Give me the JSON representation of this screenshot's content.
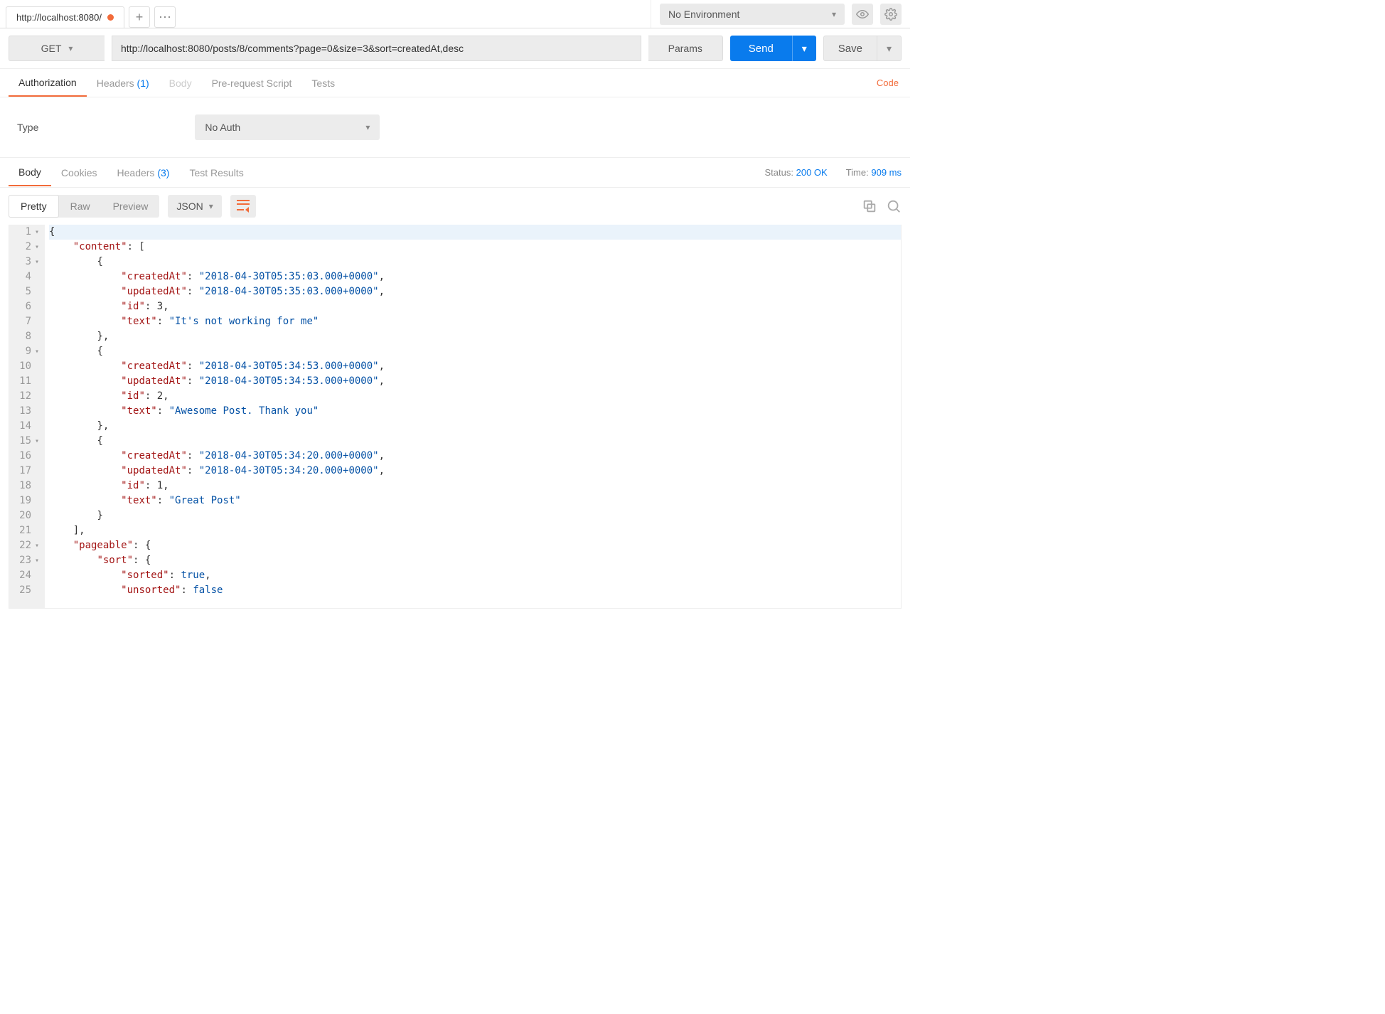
{
  "topbar": {
    "tab_title": "http://localhost:8080/",
    "environment": "No Environment"
  },
  "request": {
    "method": "GET",
    "url": "http://localhost:8080/posts/8/comments?page=0&size=3&sort=createdAt,desc",
    "params_label": "Params",
    "send_label": "Send",
    "save_label": "Save"
  },
  "req_tabs": {
    "authorization": "Authorization",
    "headers": "Headers",
    "headers_count": "(1)",
    "body": "Body",
    "prerequest": "Pre-request Script",
    "tests": "Tests",
    "code_link": "Code"
  },
  "auth": {
    "type_label": "Type",
    "selected": "No Auth"
  },
  "resp_tabs": {
    "body": "Body",
    "cookies": "Cookies",
    "headers": "Headers",
    "headers_count": "(3)",
    "tests": "Test Results"
  },
  "status": {
    "status_label": "Status:",
    "status_value": "200 OK",
    "time_label": "Time:",
    "time_value": "909 ms"
  },
  "body_toolbar": {
    "pretty": "Pretty",
    "raw": "Raw",
    "preview": "Preview",
    "format": "JSON"
  },
  "json_lines": [
    {
      "n": 1,
      "fold": true,
      "html": "<span class='p'>{</span>"
    },
    {
      "n": 2,
      "fold": true,
      "html": "    <span class='k'>\"content\"</span><span class='p'>: [</span>"
    },
    {
      "n": 3,
      "fold": true,
      "html": "        <span class='p'>{</span>"
    },
    {
      "n": 4,
      "fold": false,
      "html": "            <span class='k'>\"createdAt\"</span><span class='p'>: </span><span class='s'>\"2018-04-30T05:35:03.000+0000\"</span><span class='p'>,</span>"
    },
    {
      "n": 5,
      "fold": false,
      "html": "            <span class='k'>\"updatedAt\"</span><span class='p'>: </span><span class='s'>\"2018-04-30T05:35:03.000+0000\"</span><span class='p'>,</span>"
    },
    {
      "n": 6,
      "fold": false,
      "html": "            <span class='k'>\"id\"</span><span class='p'>: </span><span class='n'>3</span><span class='p'>,</span>"
    },
    {
      "n": 7,
      "fold": false,
      "html": "            <span class='k'>\"text\"</span><span class='p'>: </span><span class='s'>\"It's not working for me\"</span>"
    },
    {
      "n": 8,
      "fold": false,
      "html": "        <span class='p'>},</span>"
    },
    {
      "n": 9,
      "fold": true,
      "html": "        <span class='p'>{</span>"
    },
    {
      "n": 10,
      "fold": false,
      "html": "            <span class='k'>\"createdAt\"</span><span class='p'>: </span><span class='s'>\"2018-04-30T05:34:53.000+0000\"</span><span class='p'>,</span>"
    },
    {
      "n": 11,
      "fold": false,
      "html": "            <span class='k'>\"updatedAt\"</span><span class='p'>: </span><span class='s'>\"2018-04-30T05:34:53.000+0000\"</span><span class='p'>,</span>"
    },
    {
      "n": 12,
      "fold": false,
      "html": "            <span class='k'>\"id\"</span><span class='p'>: </span><span class='n'>2</span><span class='p'>,</span>"
    },
    {
      "n": 13,
      "fold": false,
      "html": "            <span class='k'>\"text\"</span><span class='p'>: </span><span class='s'>\"Awesome Post. Thank you\"</span>"
    },
    {
      "n": 14,
      "fold": false,
      "html": "        <span class='p'>},</span>"
    },
    {
      "n": 15,
      "fold": true,
      "html": "        <span class='p'>{</span>"
    },
    {
      "n": 16,
      "fold": false,
      "html": "            <span class='k'>\"createdAt\"</span><span class='p'>: </span><span class='s'>\"2018-04-30T05:34:20.000+0000\"</span><span class='p'>,</span>"
    },
    {
      "n": 17,
      "fold": false,
      "html": "            <span class='k'>\"updatedAt\"</span><span class='p'>: </span><span class='s'>\"2018-04-30T05:34:20.000+0000\"</span><span class='p'>,</span>"
    },
    {
      "n": 18,
      "fold": false,
      "html": "            <span class='k'>\"id\"</span><span class='p'>: </span><span class='n'>1</span><span class='p'>,</span>"
    },
    {
      "n": 19,
      "fold": false,
      "html": "            <span class='k'>\"text\"</span><span class='p'>: </span><span class='s'>\"Great Post\"</span>"
    },
    {
      "n": 20,
      "fold": false,
      "html": "        <span class='p'>}</span>"
    },
    {
      "n": 21,
      "fold": false,
      "html": "    <span class='p'>],</span>"
    },
    {
      "n": 22,
      "fold": true,
      "html": "    <span class='k'>\"pageable\"</span><span class='p'>: {</span>"
    },
    {
      "n": 23,
      "fold": true,
      "html": "        <span class='k'>\"sort\"</span><span class='p'>: {</span>"
    },
    {
      "n": 24,
      "fold": false,
      "html": "            <span class='k'>\"sorted\"</span><span class='p'>: </span><span class='b'>true</span><span class='p'>,</span>"
    },
    {
      "n": 25,
      "fold": false,
      "html": "            <span class='k'>\"unsorted\"</span><span class='p'>: </span><span class='b'>false</span>"
    }
  ]
}
